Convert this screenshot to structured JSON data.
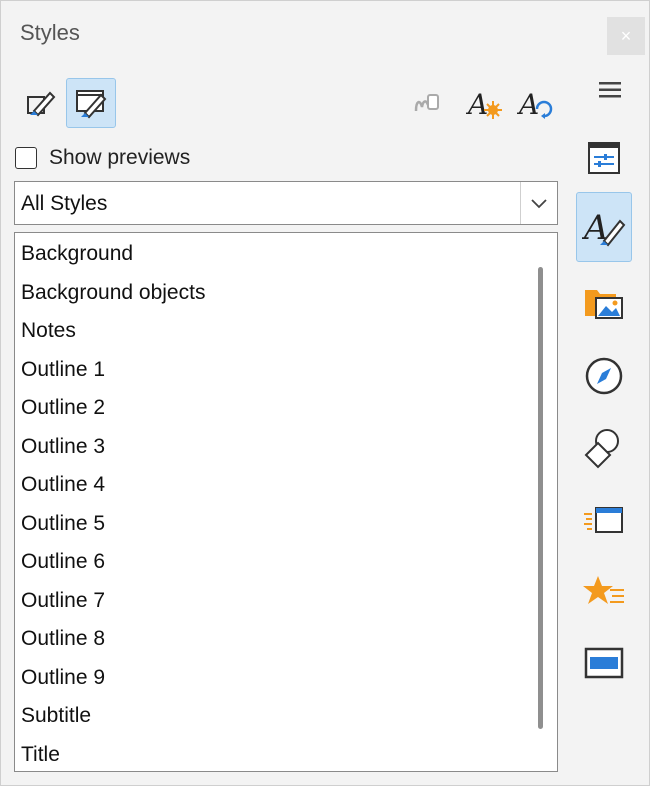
{
  "window": {
    "title": "Styles",
    "close_glyph": "×"
  },
  "toolbar": {
    "left": [
      {
        "name": "fill-format-mode-icon",
        "active": false
      },
      {
        "name": "styles-presentation-icon",
        "active": true
      }
    ],
    "right": [
      {
        "name": "fill-format-icon"
      },
      {
        "name": "new-style-icon"
      },
      {
        "name": "update-style-icon"
      }
    ]
  },
  "options": {
    "show_previews_label": "Show previews",
    "show_previews_checked": false
  },
  "filter": {
    "selected": "All Styles"
  },
  "styles_list": {
    "items": [
      "Background",
      "Background objects",
      "Notes",
      "Outline 1",
      "Outline 2",
      "Outline 3",
      "Outline 4",
      "Outline 5",
      "Outline 6",
      "Outline 7",
      "Outline 8",
      "Outline 9",
      "Subtitle",
      "Title"
    ]
  },
  "deck": {
    "menu_icon": "hamburger-menu-icon",
    "tabs": [
      {
        "name": "properties-icon",
        "active": false
      },
      {
        "name": "styles-icon",
        "active": true
      },
      {
        "name": "gallery-icon",
        "active": false
      },
      {
        "name": "navigator-icon",
        "active": false
      },
      {
        "name": "shapes-icon",
        "active": false
      },
      {
        "name": "slide-transition-icon",
        "active": false
      },
      {
        "name": "animation-icon",
        "active": false
      },
      {
        "name": "master-slides-icon",
        "active": false
      }
    ]
  },
  "colors": {
    "accent": "#2a7dd8",
    "active_bg": "#cde4f7",
    "orange": "#f39a1e"
  }
}
